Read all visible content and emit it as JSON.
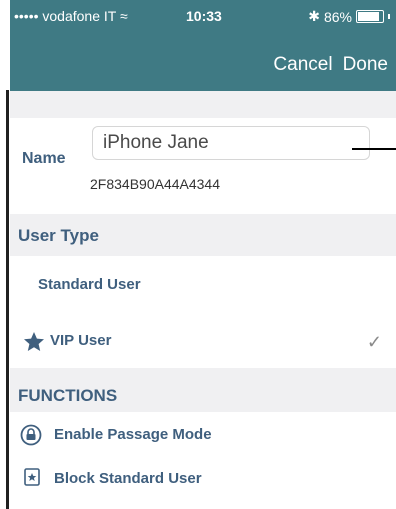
{
  "status_bar": {
    "carrier": "••••• vodafone IT ≈",
    "time": "10:33",
    "battery": "86%",
    "battery_level": 0.86
  },
  "nav": {
    "cancel_label": "Cancel",
    "done_label": "Done"
  },
  "form": {
    "name_label": "Name",
    "name_value": "iPhone Jane",
    "device_id": "2F834B90A44A4344"
  },
  "user_type": {
    "title": "User Type",
    "options": [
      {
        "label": "Standard User",
        "selected": false
      },
      {
        "label": "VIP User",
        "selected": true,
        "icon": "star-icon"
      }
    ],
    "checkmark": "✓"
  },
  "functions": {
    "title": "FUNCTIONS",
    "items": [
      {
        "label": "Enable Passage Mode",
        "icon": "lock-icon"
      },
      {
        "label": "Block Standard User",
        "icon": "star-box-icon"
      }
    ]
  },
  "colors": {
    "header_bg": "#3f7a84",
    "label_color": "#3f5f7e",
    "section_bg": "#f0f0f2"
  }
}
